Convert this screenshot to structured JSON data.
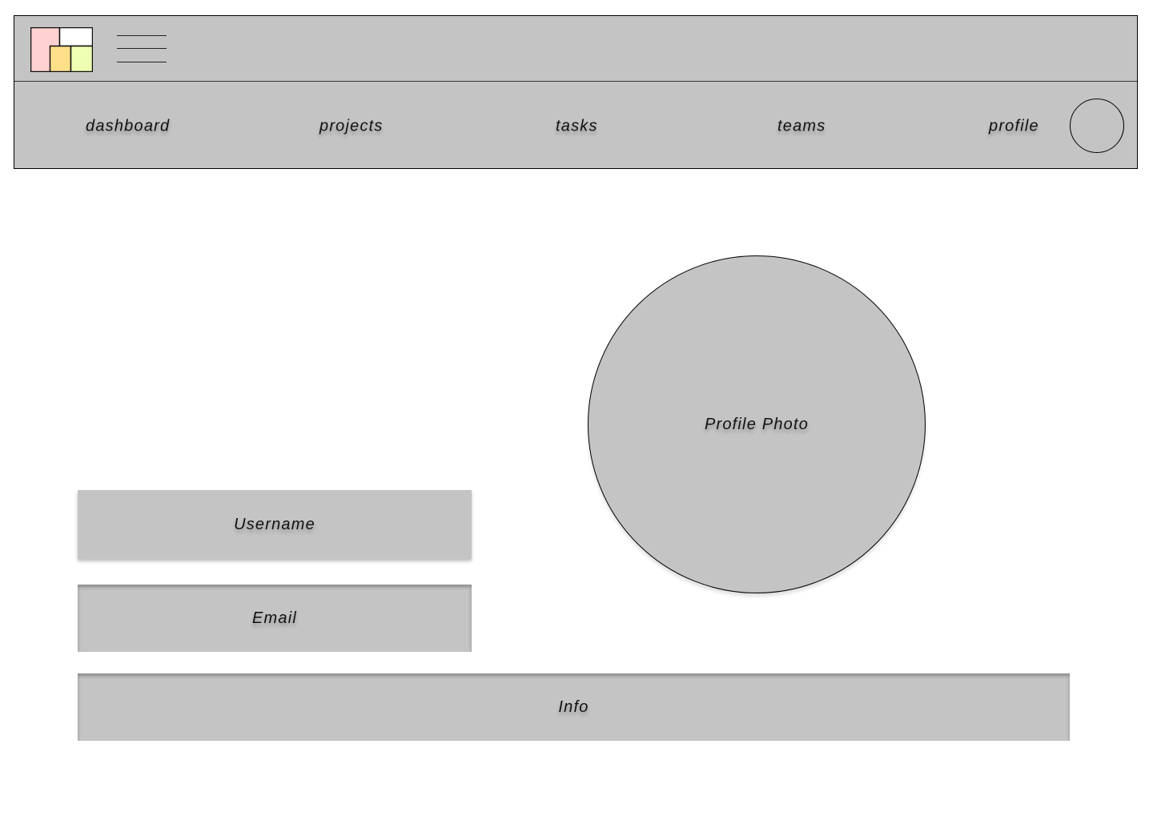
{
  "header": {
    "logo_icon": "layout-grid-logo-icon",
    "menu_icon": "hamburger-menu-icon",
    "colors": {
      "background": "#c4c4c4",
      "logo_tile_pink": "#ffd1d1",
      "logo_tile_white": "#ffffff",
      "logo_tile_yellow": "#ffe08a",
      "logo_tile_lime": "#eeffb3"
    }
  },
  "nav": {
    "items": [
      {
        "label": "dashboard"
      },
      {
        "label": "projects"
      },
      {
        "label": "tasks"
      },
      {
        "label": "teams"
      },
      {
        "label": "profile"
      }
    ],
    "avatar_icon": "user-avatar-icon"
  },
  "profile": {
    "photo_label": "Profile Photo",
    "username_label": "Username",
    "email_label": "Email",
    "info_label": "Info"
  }
}
